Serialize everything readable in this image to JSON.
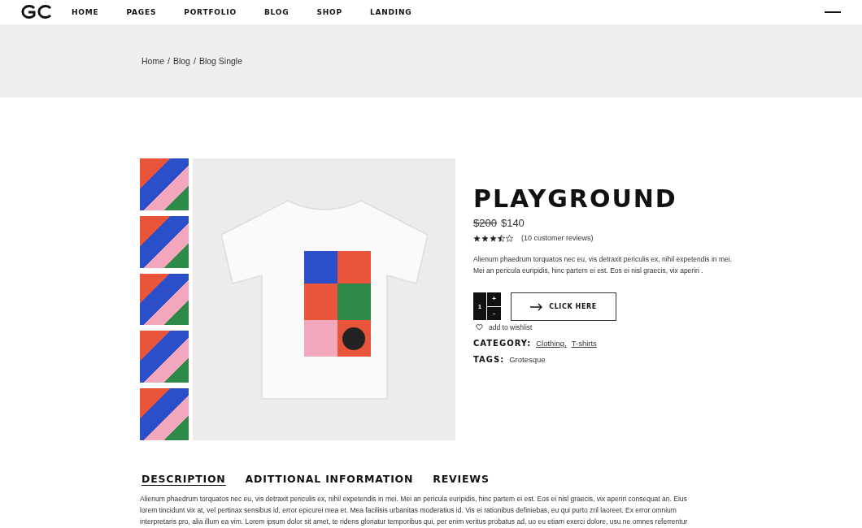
{
  "nav": {
    "items": [
      "HOME",
      "PAGES",
      "PORTFOLIO",
      "BLOG",
      "SHOP",
      "LANDING"
    ]
  },
  "breadcrumb": [
    "Home",
    "/",
    "Blog",
    "/",
    "Blog Single"
  ],
  "product": {
    "title": "PLAYGROUND",
    "old_price": "$200",
    "price": "$140",
    "stars": 3.5,
    "reviews": "(10 customer reviews)",
    "summary": "Alienum phaedrum torquatos nec eu, vis detraxit periculis ex, nihil expetendis in mei. Mei an pericula euripidis, hinc partem ei est. Eos ei nisl graecis, vix aperiri .",
    "quantity": "1",
    "plus": "+",
    "minus": "-",
    "button": "CLICK HERE",
    "wishlist": "add to wishlist",
    "category_label": "CATEGORY:",
    "categories": [
      "Clothing,",
      "T-shirts"
    ],
    "tags_label": "TAGS:",
    "tags": "Grotesque"
  },
  "tabs": [
    {
      "label": "DESCRIPTION",
      "selected": true
    },
    {
      "label": "ADITTIONAL INFORMATION",
      "selected": false
    },
    {
      "label": "REVIEWS",
      "selected": false
    }
  ],
  "description": "Alienum phaedrum torquatos nec eu, vis detraxit periculis ex, nihil expetendis in mei. Mei an pericula euripidis, hinc partem ei est. Eos ei nisl graecis, vix aperiri consequat an. Eius lorem tincidunt vix at, vel pertinax sensibus id, error epicurei mea et. Mea facilisis urbanitas moderatius id. Vis ei rationibus definiebas, eu qui purto zril laoreet. Ex error omnium interpretaris pro, alia illum ea vim. Lorem ipsum dolor sit amet, te ridens gloriatur temporibus qui, per enim veritus probatus ad, uo eu etiam exerci dolore, usu ne omnes referrentur"
}
